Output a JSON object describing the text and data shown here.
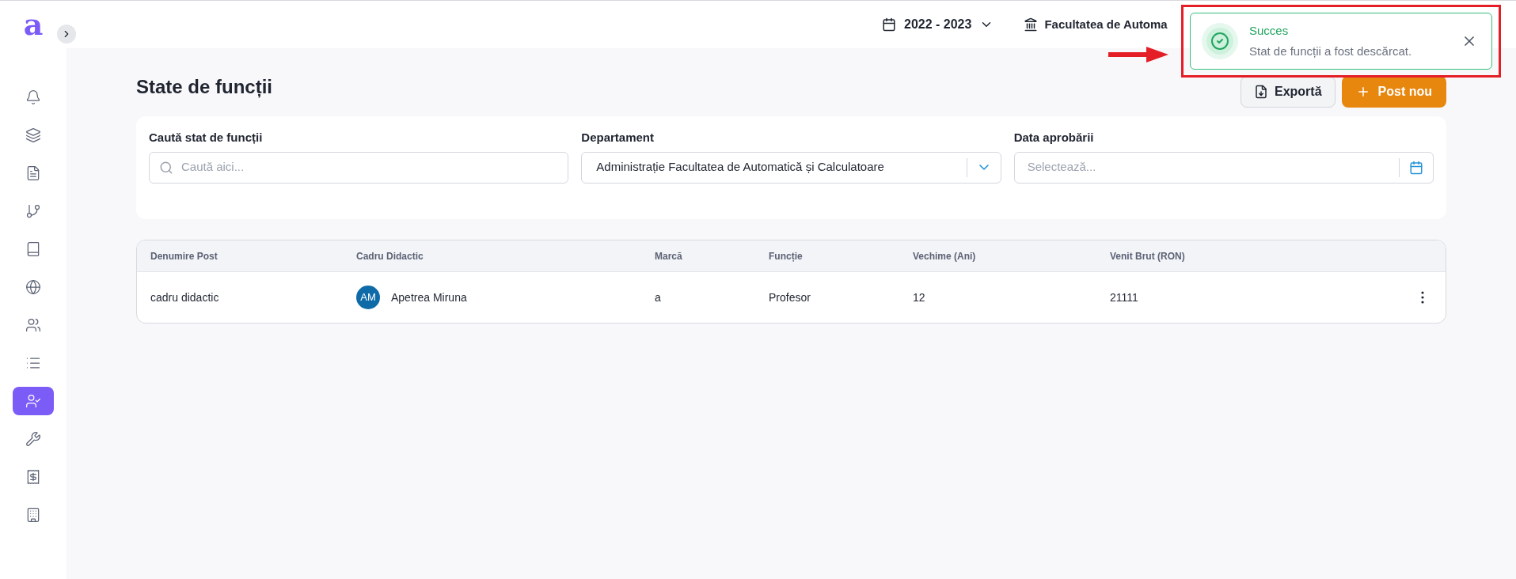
{
  "sidebar": {
    "logo": "a",
    "items": [
      {
        "kind": "bell",
        "selected": false
      },
      {
        "kind": "layers",
        "selected": false
      },
      {
        "kind": "document",
        "selected": false
      },
      {
        "kind": "route",
        "selected": false
      },
      {
        "kind": "notebook",
        "selected": false
      },
      {
        "kind": "globe",
        "selected": false
      },
      {
        "kind": "users",
        "selected": false
      },
      {
        "kind": "list",
        "selected": false
      },
      {
        "kind": "user-check",
        "selected": true
      },
      {
        "kind": "wrench",
        "selected": false
      },
      {
        "kind": "receipt",
        "selected": false
      },
      {
        "kind": "building",
        "selected": false
      }
    ]
  },
  "topbar": {
    "year": "2022 - 2023",
    "faculty": "Facultatea de Automa"
  },
  "toast": {
    "title": "Succes",
    "message": "Stat de funcții a fost descărcat."
  },
  "page": {
    "title": "State de funcții",
    "buttons": [
      {
        "kind": "export",
        "label": "Exportă"
      },
      {
        "kind": "add",
        "label": "Post nou"
      }
    ]
  },
  "filters": [
    {
      "kind": "search",
      "label": "Caută stat de funcții",
      "placeholder": "Caută aici..."
    },
    {
      "kind": "select",
      "label": "Departament",
      "value": "Administrație Facultatea de Automatică și Calculatoare"
    },
    {
      "kind": "date",
      "label": "Data aprobării",
      "placeholder": "Selectează..."
    }
  ],
  "table": {
    "columns": [
      "Denumire Post",
      "Cadru Didactic",
      "Marcă",
      "Funcție",
      "Vechime (Ani)",
      "Venit Brut (RON)"
    ],
    "rows": [
      {
        "post": "cadru didactic",
        "avatar": "AM",
        "name": "Apetrea Miruna",
        "marca": "a",
        "functie": "Profesor",
        "vechime": "12",
        "venit": "21111"
      }
    ]
  }
}
